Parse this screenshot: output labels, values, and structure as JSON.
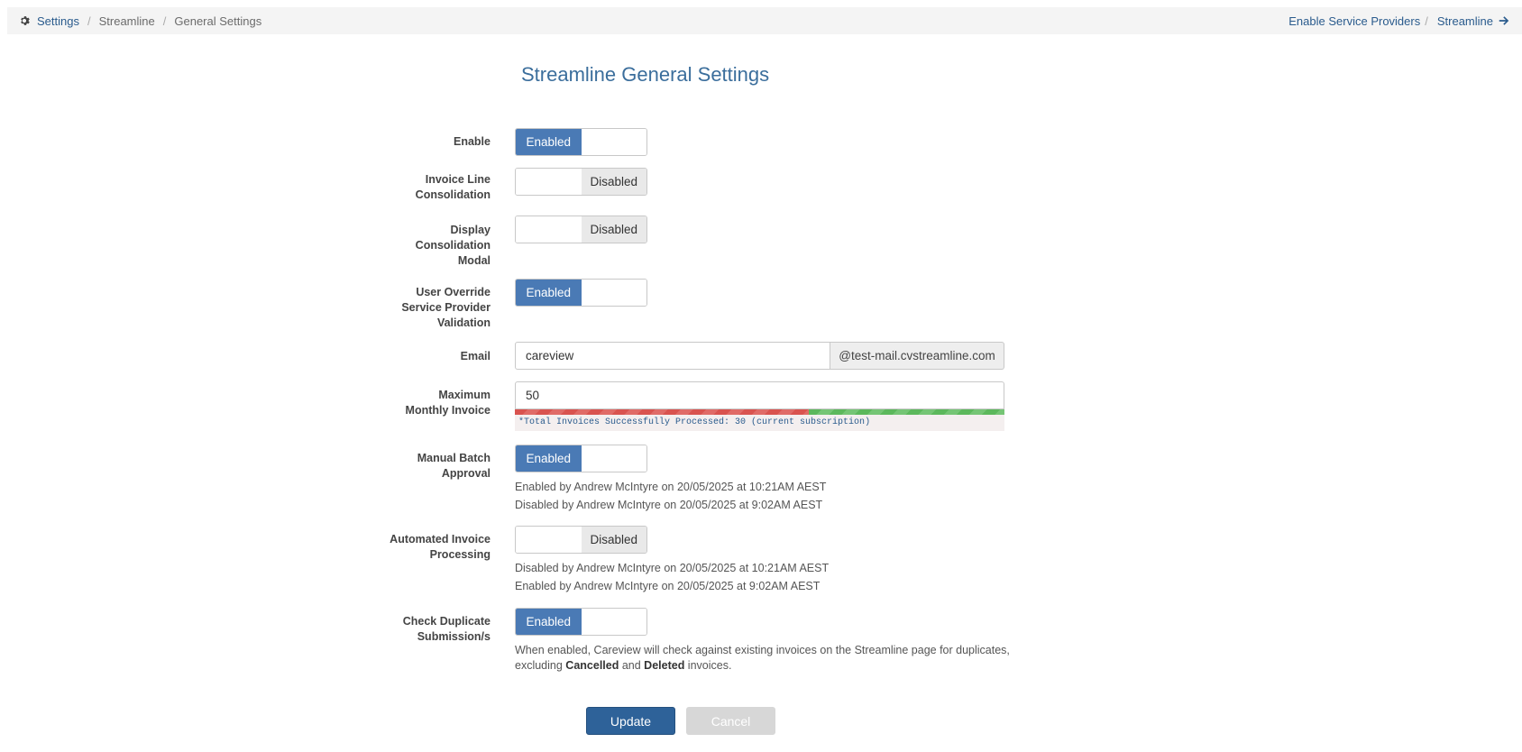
{
  "breadcrumb": {
    "items": [
      "Settings",
      "Streamline",
      "General Settings"
    ],
    "separator": "/"
  },
  "nav_links": {
    "enable_service_providers": "Enable Service Providers",
    "separator": "/",
    "streamline": "Streamline"
  },
  "page_title": "Streamline General Settings",
  "fields": {
    "enable": {
      "label": "Enable",
      "state": "Enabled"
    },
    "invoice_line_consolidation": {
      "label": "Invoice Line Consolidation",
      "state": "Disabled"
    },
    "display_consolidation_modal": {
      "label": "Display Consolidation Modal",
      "state": "Disabled"
    },
    "user_override": {
      "label": "User Override Service Provider Validation",
      "state": "Enabled"
    },
    "email": {
      "label": "Email",
      "value": "careview",
      "suffix": "@test-mail.cvstreamline.com"
    },
    "max_monthly_invoice": {
      "label": "Maximum Monthly Invoice",
      "value": "50",
      "progress_fraction": 0.6,
      "note": "*Total Invoices Successfully Processed: 30 (current subscription)"
    },
    "manual_batch_approval": {
      "label": "Manual Batch Approval",
      "state": "Enabled",
      "history": [
        "Enabled by Andrew McIntyre on 20/05/2025 at 10:21AM AEST",
        "Disabled by Andrew McIntyre on 20/05/2025 at 9:02AM AEST"
      ]
    },
    "automated_invoice_processing": {
      "label": "Automated Invoice Processing",
      "state": "Disabled",
      "history": [
        "Disabled by Andrew McIntyre on 20/05/2025 at 10:21AM AEST",
        "Enabled by Andrew McIntyre on 20/05/2025 at 9:02AM AEST"
      ]
    },
    "check_duplicate": {
      "label": "Check Duplicate Submission/s",
      "state": "Enabled",
      "help_pre": "When enabled, Careview will check against existing invoices on the Streamline page for duplicates, excluding ",
      "help_bold_1": "Cancelled",
      "help_mid": " and ",
      "help_bold_2": "Deleted",
      "help_post": " invoices."
    }
  },
  "buttons": {
    "update": "Update",
    "cancel": "Cancel"
  },
  "colors": {
    "accent": "#4a7ab5",
    "link": "#2a5b8d",
    "primary_button": "#2e6299",
    "danger": "#d9534f",
    "success": "#5cb85c"
  },
  "icons": {
    "settings": "gear-icon",
    "streamline_link": "arrow-right-icon"
  }
}
